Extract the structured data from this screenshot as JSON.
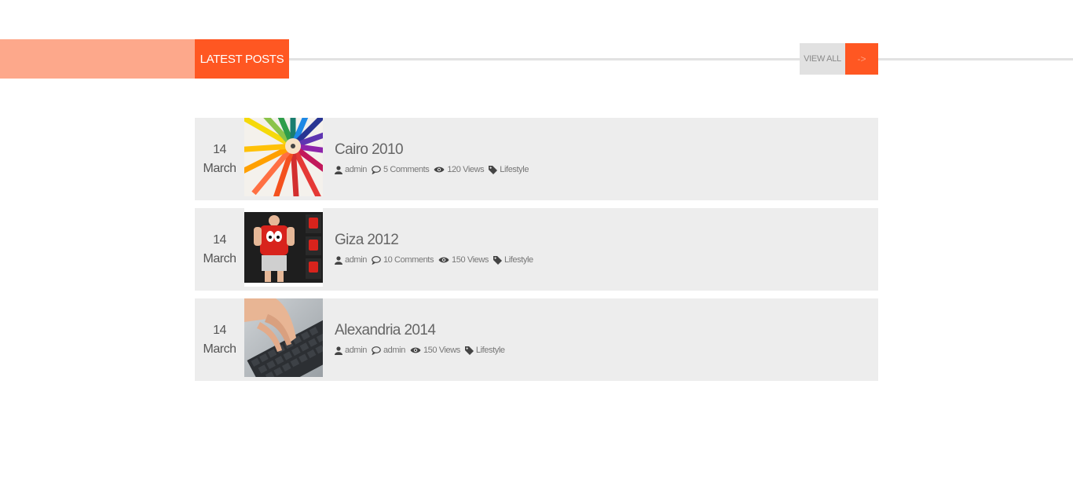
{
  "section": {
    "title": "LATEST POSTS",
    "view_all_label": "VIEW ALL",
    "arrow_label": "->"
  },
  "colors": {
    "accent": "#ff5722",
    "accent_light": "#fda88b",
    "row_bg": "#ededed"
  },
  "posts": [
    {
      "day": "14",
      "month": "March",
      "title": "Cairo 2010",
      "author": "admin",
      "comments": "5 Comments",
      "views": "120 Views",
      "category": "Lifestyle",
      "thumb_icon": "colored-pencils-photo"
    },
    {
      "day": "14",
      "month": "March",
      "title": "Giza 2012",
      "author": "admin",
      "comments": "10 Comments",
      "views": "150 Views",
      "category": "Lifestyle",
      "thumb_icon": "kids-tshirt-photo"
    },
    {
      "day": "14",
      "month": "March",
      "title": "Alexandria 2014",
      "author": "admin",
      "comments": "admin",
      "views": "150 Views",
      "category": "Lifestyle",
      "thumb_icon": "keyboard-hand-photo"
    }
  ]
}
